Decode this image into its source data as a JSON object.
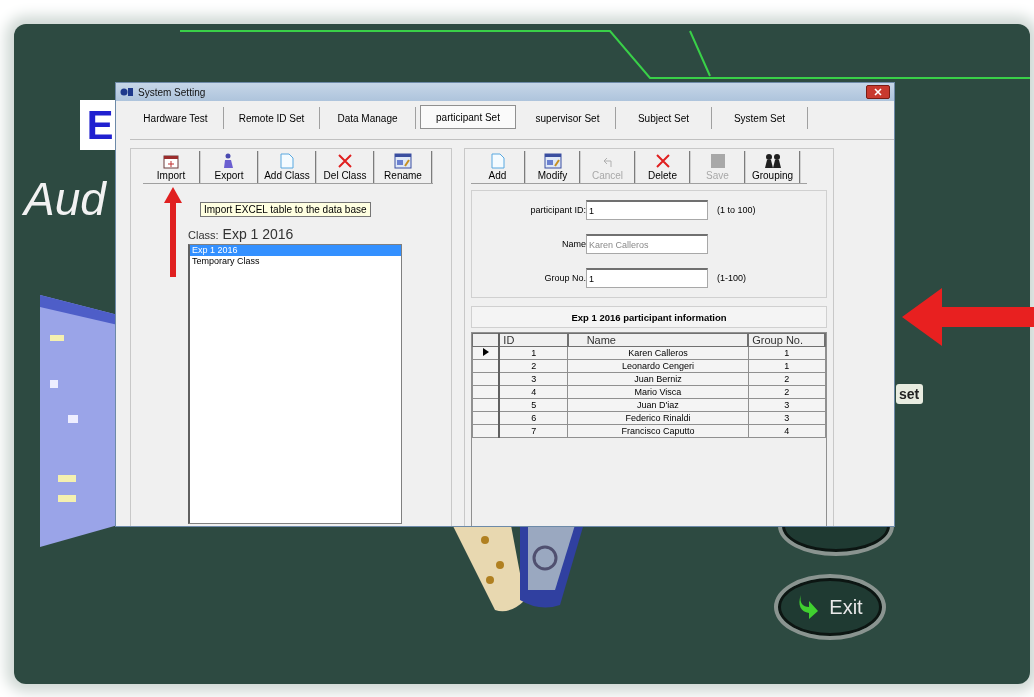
{
  "background_app": {
    "logo_text": "E",
    "title_text": "Aud",
    "buttons": [
      {
        "label": "set"
      },
      {
        "label": "Exit"
      }
    ]
  },
  "dialog": {
    "title": "System Setting",
    "tabs": [
      {
        "label": "Hardware Test",
        "selected": false
      },
      {
        "label": "Remote ID Set",
        "selected": false
      },
      {
        "label": "Data Manage",
        "selected": false
      },
      {
        "label": "participant Set",
        "selected": true
      },
      {
        "label": "supervisor Set",
        "selected": false
      },
      {
        "label": "Subject Set",
        "selected": false
      },
      {
        "label": "System Set",
        "selected": false
      }
    ],
    "class_toolbar": [
      {
        "kind": "import",
        "label": "Import",
        "disabled": false
      },
      {
        "kind": "export",
        "label": "Export",
        "disabled": false
      },
      {
        "kind": "add",
        "label": "Add Class",
        "disabled": false
      },
      {
        "kind": "delete",
        "label": "Del Class",
        "disabled": false
      },
      {
        "kind": "rename",
        "label": "Rename",
        "disabled": false
      }
    ],
    "tooltip": "Import EXCEL table to the data base",
    "class_label": "Class:",
    "class_value": "Exp 1 2016",
    "class_list": [
      {
        "label": "Exp 1 2016",
        "selected": true
      },
      {
        "label": "Temporary Class",
        "selected": false
      }
    ],
    "participant_toolbar": [
      {
        "kind": "add",
        "label": "Add",
        "disabled": false
      },
      {
        "kind": "rename",
        "label": "Modify",
        "disabled": false
      },
      {
        "kind": "cancel",
        "label": "Cancel",
        "disabled": true
      },
      {
        "kind": "delete",
        "label": "Delete",
        "disabled": false
      },
      {
        "kind": "save",
        "label": "Save",
        "disabled": true
      },
      {
        "kind": "grouping",
        "label": "Grouping",
        "disabled": false
      }
    ],
    "form": [
      {
        "label": "participant ID:",
        "value": "1",
        "hint": "(1 to 100)",
        "disabled": false
      },
      {
        "label": "Name",
        "value": "Karen Calleros",
        "disabled": true
      },
      {
        "label": "Group No.",
        "value": "1",
        "hint": "(1-100)",
        "disabled": false
      }
    ],
    "table": {
      "title": "Exp 1 2016 participant information",
      "columns": [
        "ID",
        "Name",
        "Group No."
      ],
      "rows": [
        {
          "selected": true,
          "cells": [
            "1",
            "Karen Calleros",
            "1"
          ]
        },
        {
          "selected": false,
          "cells": [
            "2",
            "Leonardo Cengeri",
            "1"
          ]
        },
        {
          "selected": false,
          "cells": [
            "3",
            "Juan Berniz",
            "2"
          ]
        },
        {
          "selected": false,
          "cells": [
            "4",
            "Mario Visca",
            "2"
          ]
        },
        {
          "selected": false,
          "cells": [
            "5",
            "Juan D'iaz",
            "3"
          ]
        },
        {
          "selected": false,
          "cells": [
            "6",
            "Federico Rinaldi",
            "3"
          ]
        },
        {
          "selected": false,
          "cells": [
            "7",
            "Francisco Caputto",
            "4"
          ]
        }
      ]
    }
  }
}
